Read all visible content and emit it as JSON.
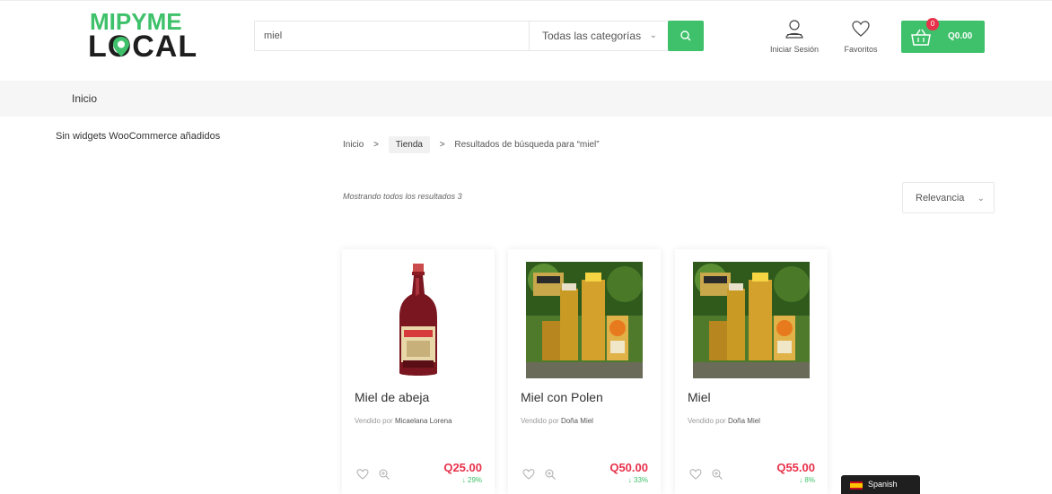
{
  "brand": {
    "line1": "MIPYME",
    "line2": "LOCAL",
    "colors": {
      "green": "#3ec16a",
      "dark": "#1e1e1e",
      "price_red": "#e8324b"
    }
  },
  "search": {
    "value": "miel",
    "placeholder": "",
    "category_selected": "Todas las categorías",
    "button_icon": "search-icon"
  },
  "header_actions": {
    "login_label": "Iniciar Sesión",
    "favorites_label": "Favoritos",
    "cart_count": "0",
    "cart_total": "Q0.00"
  },
  "nav": {
    "items": [
      {
        "label": "Inicio"
      }
    ]
  },
  "sidebar": {
    "note": "Sin widgets WooCommerce añadidos"
  },
  "breadcrumb": {
    "items": [
      {
        "label": "Inicio"
      },
      {
        "label": "Tienda"
      },
      {
        "label": "Resultados de búsqueda para “miel”"
      }
    ],
    "separator": ">"
  },
  "results": {
    "count_text": "Mostrando todos los resultados 3",
    "sort_selected": "Relevancia"
  },
  "products": [
    {
      "title": "Miel de abeja",
      "seller_prefix": "Vendido por",
      "seller": "Micaelana Lorena",
      "price": "Q25.00",
      "discount": "↓ 29%"
    },
    {
      "title": "Miel con Polen",
      "seller_prefix": "Vendido por",
      "seller": "Doña Miel",
      "price": "Q50.00",
      "discount": "↓ 33%"
    },
    {
      "title": "Miel",
      "seller_prefix": "Vendido por",
      "seller": "Doña Miel",
      "price": "Q55.00",
      "discount": "↓ 8%"
    }
  ],
  "language": {
    "label": "Spanish"
  }
}
